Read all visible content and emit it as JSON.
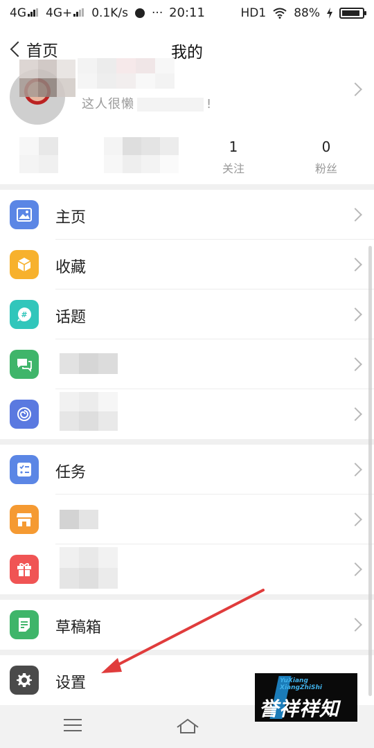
{
  "status_bar": {
    "network1": "4G",
    "network2": "4G+",
    "speed": "0.1K/s",
    "more": "···",
    "time": "20:11",
    "hd": "HD1",
    "battery_percent": "88%",
    "battery_level": 0.88
  },
  "navbar": {
    "back_label": "首页",
    "title": "我的"
  },
  "profile": {
    "bio_partial": "这人很懒",
    "bio_end": "!"
  },
  "stats": [
    {
      "value": "1",
      "label": "关注"
    },
    {
      "value": "0",
      "label": "粉丝"
    }
  ],
  "menu_groups": [
    {
      "items": [
        {
          "label": "主页",
          "icon": "image-icon",
          "color": "#5b86e5"
        },
        {
          "label": "收藏",
          "icon": "cube-icon",
          "color": "#f7b12d"
        },
        {
          "label": "话题",
          "icon": "hashtag-chat-icon",
          "color": "#31c6bb"
        },
        {
          "label": "",
          "icon": "chat-bubbles-icon",
          "color": "#3fb56a"
        },
        {
          "label": "",
          "icon": "swirl-icon",
          "color": "#5a79e0"
        }
      ]
    },
    {
      "items": [
        {
          "label": "任务",
          "icon": "checklist-icon",
          "color": "#5b86e5"
        },
        {
          "label": "",
          "icon": "store-icon",
          "color": "#f59a32"
        },
        {
          "label": "",
          "icon": "gift-icon",
          "color": "#f05454"
        }
      ]
    },
    {
      "items": [
        {
          "label": "草稿箱",
          "icon": "draft-icon",
          "color": "#3fb56a"
        }
      ]
    },
    {
      "items": [
        {
          "label": "设置",
          "icon": "gear-icon",
          "color": "#4a4a4a"
        }
      ]
    }
  ],
  "watermark": {
    "small_line1": "YuXiang",
    "small_line2": "XiangZhiShi",
    "big_text": "誉祥祥知识"
  },
  "colors": {
    "arrow": "#e03c3c",
    "gap": "#f0f0f0"
  }
}
